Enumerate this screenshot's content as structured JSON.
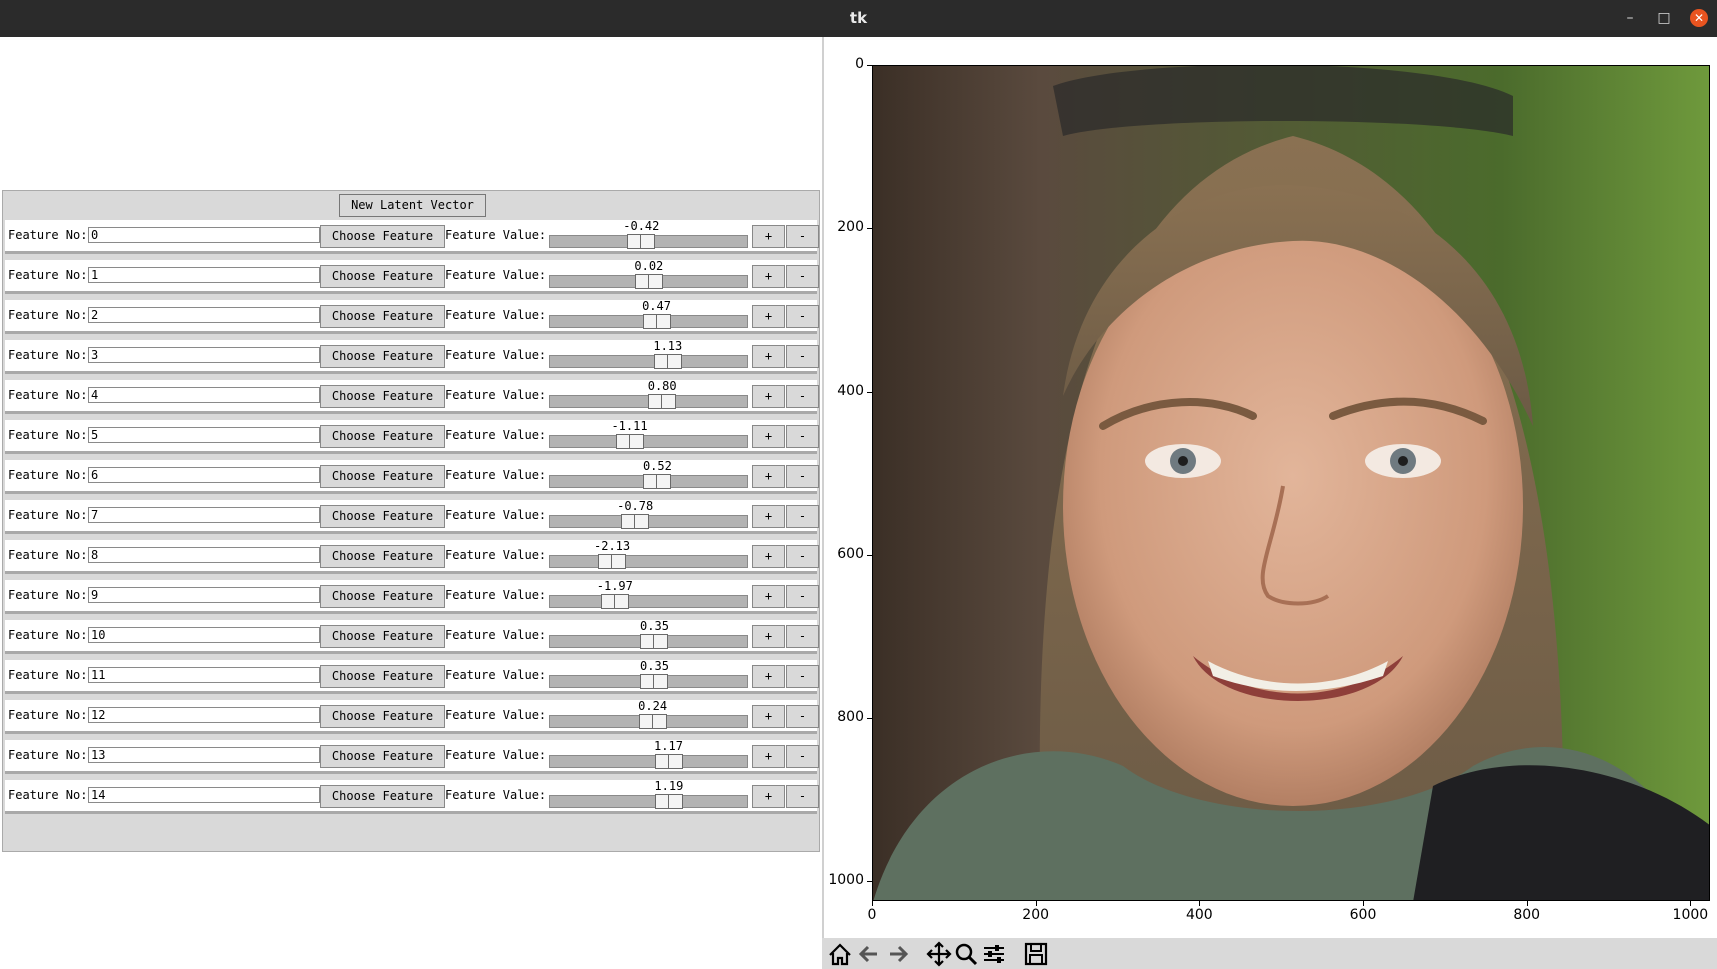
{
  "window": {
    "title": "tk"
  },
  "controls": {
    "new_latent_button": "New Latent Vector",
    "feature_no_label": "Feature No:",
    "choose_button": "Choose Feature",
    "feature_value_label": "Feature Value:",
    "plus": "+",
    "minus": "-",
    "scale_range": [
      -5,
      5
    ],
    "features": [
      {
        "no": "0",
        "value": "-0.42"
      },
      {
        "no": "1",
        "value": "0.02"
      },
      {
        "no": "2",
        "value": "0.47"
      },
      {
        "no": "3",
        "value": "1.13"
      },
      {
        "no": "4",
        "value": "0.80"
      },
      {
        "no": "5",
        "value": "-1.11"
      },
      {
        "no": "6",
        "value": "0.52"
      },
      {
        "no": "7",
        "value": "-0.78"
      },
      {
        "no": "8",
        "value": "-2.13"
      },
      {
        "no": "9",
        "value": "-1.97"
      },
      {
        "no": "10",
        "value": "0.35"
      },
      {
        "no": "11",
        "value": "0.35"
      },
      {
        "no": "12",
        "value": "0.24"
      },
      {
        "no": "13",
        "value": "1.17"
      },
      {
        "no": "14",
        "value": "1.19"
      }
    ]
  },
  "plot": {
    "y_ticks": [
      "0",
      "200",
      "400",
      "600",
      "800",
      "1000"
    ],
    "x_ticks": [
      "0",
      "200",
      "400",
      "600",
      "800",
      "1000"
    ],
    "x_range": [
      0,
      1024
    ],
    "y_range": [
      0,
      1024
    ],
    "image_subject": "generated face portrait"
  },
  "toolbar": {
    "icons": [
      "home-icon",
      "back-arrow-icon",
      "forward-arrow-icon",
      "pan-icon",
      "zoom-icon",
      "configure-subplots-icon",
      "save-icon"
    ]
  }
}
